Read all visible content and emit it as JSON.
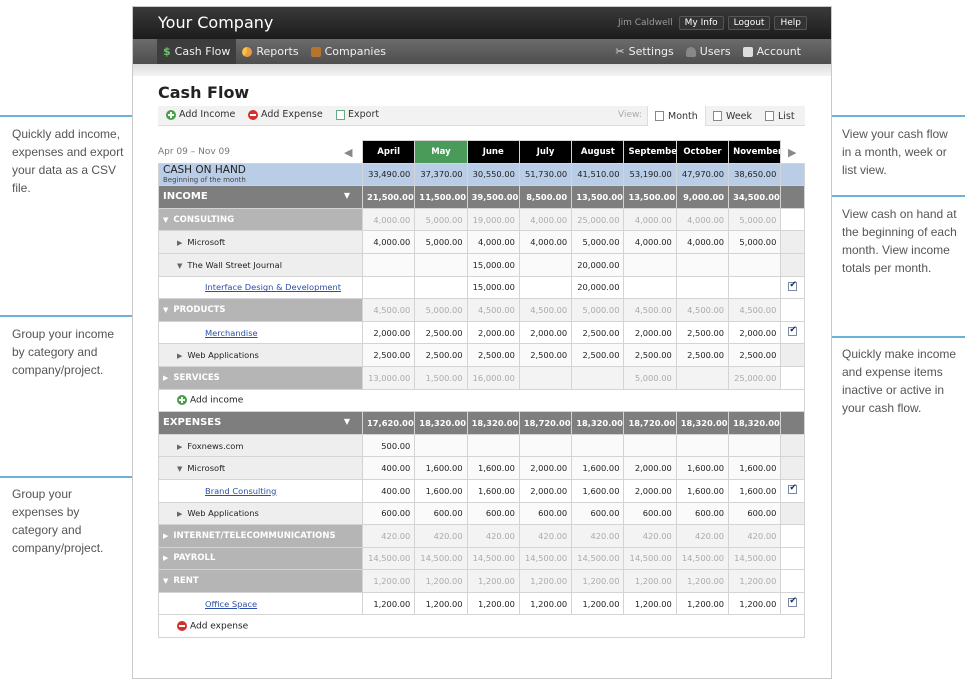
{
  "callouts": {
    "left1": "Quickly add income, expenses and export your data as a CSV file.",
    "left2": "Group your income by category and company/project.",
    "left3": "Group your expenses by category and company/project.",
    "right1": "View your cash flow in a month, week or list view.",
    "right2": "View cash on hand at the beginning of each month. View income totals per month.",
    "right3": "Quickly make income and expense items inactive or active in your cash flow."
  },
  "header": {
    "company": "Your Company",
    "user": "Jim Caldwell",
    "links": [
      "My Info",
      "Logout",
      "Help"
    ]
  },
  "nav": {
    "left": [
      {
        "label": "Cash Flow",
        "icon": "dollar-icon",
        "active": true
      },
      {
        "label": "Reports",
        "icon": "pie-chart-icon"
      },
      {
        "label": "Companies",
        "icon": "briefcase-icon"
      }
    ],
    "right": [
      {
        "label": "Settings",
        "icon": "wrench-icon"
      },
      {
        "label": "Users",
        "icon": "users-icon"
      },
      {
        "label": "Account",
        "icon": "folder-icon"
      }
    ]
  },
  "page": {
    "title": "Cash Flow",
    "toolbar": {
      "add_income": "Add Income",
      "add_expense": "Add Expense",
      "export": "Export"
    },
    "view": {
      "label": "View:",
      "month": "Month",
      "week": "Week",
      "list": "List"
    },
    "date_range": "Apr 09 – Nov 09"
  },
  "months": [
    "April",
    "May",
    "June",
    "July",
    "August",
    "September",
    "October",
    "November"
  ],
  "cash_on_hand": {
    "title": "CASH ON HAND",
    "subtitle": "Beginning of the month",
    "values": [
      "33,490.00",
      "37,370.00",
      "30,550.00",
      "51,730.00",
      "41,510.00",
      "53,190.00",
      "47,970.00",
      "38,650.00"
    ]
  },
  "income": {
    "label": "INCOME",
    "totals": [
      "21,500.00",
      "11,500.00",
      "39,500.00",
      "8,500.00",
      "13,500.00",
      "13,500.00",
      "9,000.00",
      "34,500.00"
    ],
    "rows": [
      {
        "kind": "cat",
        "label": "CONSULTING",
        "expanded": true,
        "values": [
          "4,000.00",
          "5,000.00",
          "19,000.00",
          "4,000.00",
          "25,000.00",
          "4,000.00",
          "4,000.00",
          "5,000.00"
        ]
      },
      {
        "kind": "company",
        "label": "Microsoft",
        "expanded": false,
        "values": [
          "4,000.00",
          "5,000.00",
          "4,000.00",
          "4,000.00",
          "5,000.00",
          "4,000.00",
          "4,000.00",
          "5,000.00"
        ]
      },
      {
        "kind": "company",
        "label": "The Wall Street Journal",
        "expanded": true,
        "values": [
          "",
          "",
          "15,000.00",
          "",
          "20,000.00",
          "",
          "",
          ""
        ]
      },
      {
        "kind": "item",
        "label": "Interface Design & Development",
        "checked": true,
        "values": [
          "",
          "",
          "15,000.00",
          "",
          "20,000.00",
          "",
          "",
          ""
        ]
      },
      {
        "kind": "cat",
        "label": "PRODUCTS",
        "expanded": true,
        "values": [
          "4,500.00",
          "5,000.00",
          "4,500.00",
          "4,500.00",
          "5,000.00",
          "4,500.00",
          "4,500.00",
          "4,500.00"
        ]
      },
      {
        "kind": "item",
        "label": "Merchandise",
        "checked": true,
        "values": [
          "2,000.00",
          "2,500.00",
          "2,000.00",
          "2,000.00",
          "2,500.00",
          "2,000.00",
          "2,500.00",
          "2,000.00"
        ]
      },
      {
        "kind": "company",
        "label": "Web Applications",
        "expanded": false,
        "values": [
          "2,500.00",
          "2,500.00",
          "2,500.00",
          "2,500.00",
          "2,500.00",
          "2,500.00",
          "2,500.00",
          "2,500.00"
        ]
      },
      {
        "kind": "cat",
        "label": "SERVICES",
        "expanded": false,
        "values": [
          "13,000.00",
          "1,500.00",
          "16,000.00",
          "",
          "",
          "5,000.00",
          "",
          "25,000.00"
        ]
      }
    ],
    "add_label": "Add income"
  },
  "expenses": {
    "label": "EXPENSES",
    "totals": [
      "17,620.00",
      "18,320.00",
      "18,320.00",
      "18,720.00",
      "18,320.00",
      "18,720.00",
      "18,320.00",
      "18,320.00"
    ],
    "rows": [
      {
        "kind": "company",
        "label": "Foxnews.com",
        "expanded": false,
        "values": [
          "500.00",
          "",
          "",
          "",
          "",
          "",
          "",
          ""
        ]
      },
      {
        "kind": "company",
        "label": "Microsoft",
        "expanded": true,
        "values": [
          "400.00",
          "1,600.00",
          "1,600.00",
          "2,000.00",
          "1,600.00",
          "2,000.00",
          "1,600.00",
          "1,600.00"
        ]
      },
      {
        "kind": "item",
        "label": "Brand Consulting",
        "checked": true,
        "values": [
          "400.00",
          "1,600.00",
          "1,600.00",
          "2,000.00",
          "1,600.00",
          "2,000.00",
          "1,600.00",
          "1,600.00"
        ]
      },
      {
        "kind": "company",
        "label": "Web Applications",
        "expanded": false,
        "values": [
          "600.00",
          "600.00",
          "600.00",
          "600.00",
          "600.00",
          "600.00",
          "600.00",
          "600.00"
        ]
      },
      {
        "kind": "cat",
        "label": "INTERNET/TELECOMMUNICATIONS",
        "expanded": false,
        "values": [
          "420.00",
          "420.00",
          "420.00",
          "420.00",
          "420.00",
          "420.00",
          "420.00",
          "420.00"
        ]
      },
      {
        "kind": "cat",
        "label": "PAYROLL",
        "expanded": false,
        "values": [
          "14,500.00",
          "14,500.00",
          "14,500.00",
          "14,500.00",
          "14,500.00",
          "14,500.00",
          "14,500.00",
          "14,500.00"
        ]
      },
      {
        "kind": "cat",
        "label": "RENT",
        "expanded": true,
        "values": [
          "1,200.00",
          "1,200.00",
          "1,200.00",
          "1,200.00",
          "1,200.00",
          "1,200.00",
          "1,200.00",
          "1,200.00"
        ]
      },
      {
        "kind": "item",
        "label": "Office Space",
        "checked": true,
        "values": [
          "1,200.00",
          "1,200.00",
          "1,200.00",
          "1,200.00",
          "1,200.00",
          "1,200.00",
          "1,200.00",
          "1,200.00"
        ]
      }
    ],
    "add_label": "Add expense"
  }
}
